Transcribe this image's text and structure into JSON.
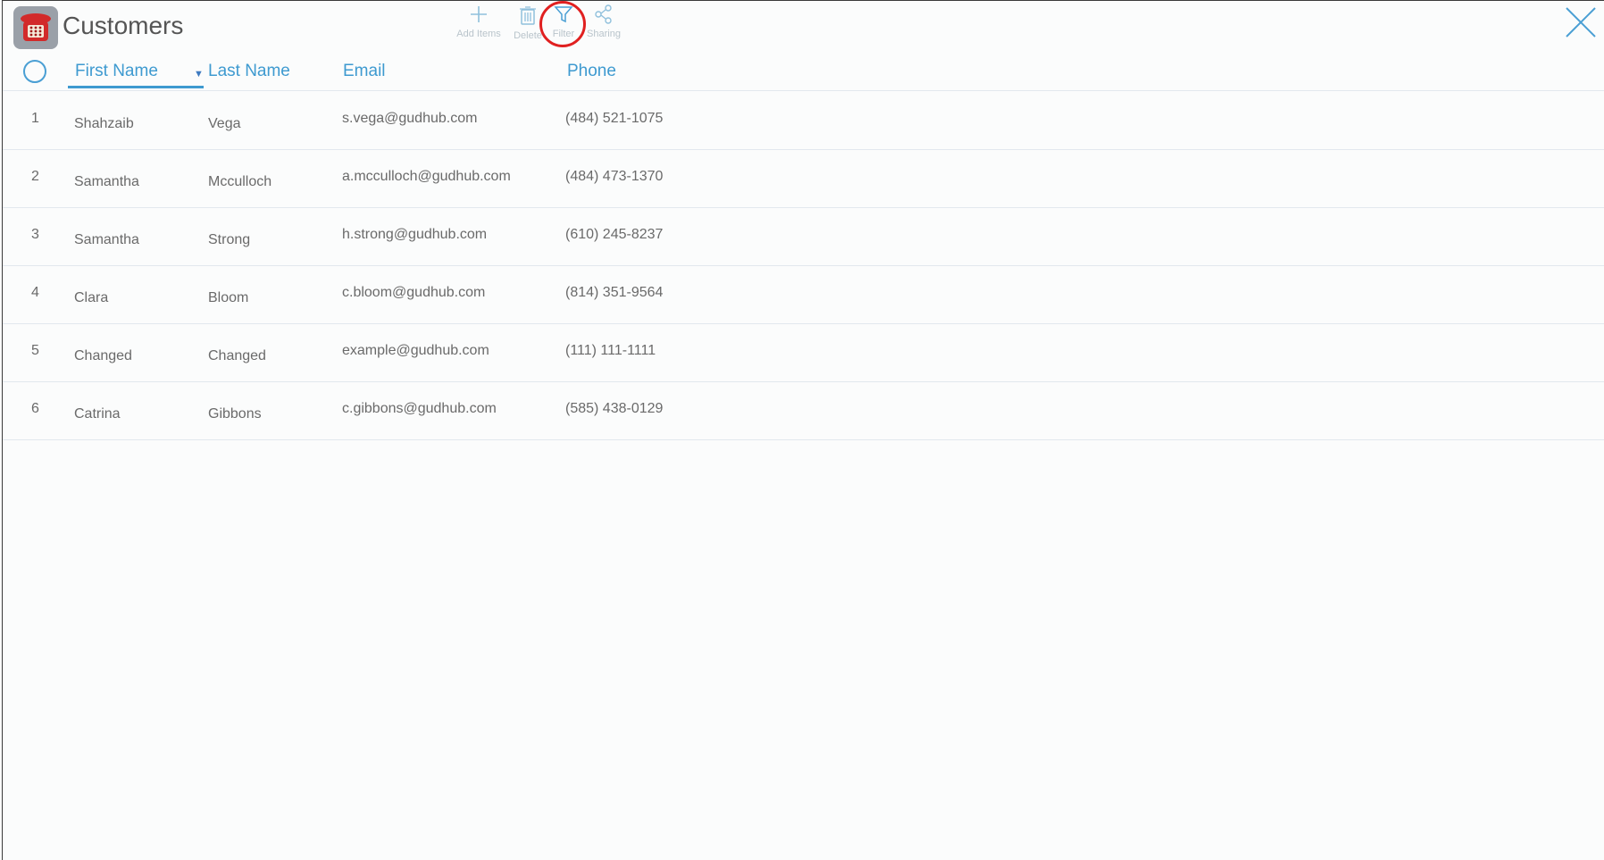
{
  "header": {
    "title": "Customers",
    "toolbar": {
      "add_label": "Add Items",
      "delete_label": "Delete",
      "filter_label": "Filter",
      "sharing_label": "Sharing"
    }
  },
  "table": {
    "columns": [
      "First Name",
      "Last Name",
      "Email",
      "Phone"
    ],
    "rows": [
      {
        "num": "1",
        "first": "Shahzaib",
        "last": "Vega",
        "email": "s.vega@gudhub.com",
        "phone": "(484) 521-1075"
      },
      {
        "num": "2",
        "first": "Samantha",
        "last": "Mcculloch",
        "email": "a.mcculloch@gudhub.com",
        "phone": "(484) 473-1370"
      },
      {
        "num": "3",
        "first": "Samantha",
        "last": "Strong",
        "email": "h.strong@gudhub.com",
        "phone": "(610) 245-8237"
      },
      {
        "num": "4",
        "first": "Clara",
        "last": "Bloom",
        "email": "c.bloom@gudhub.com",
        "phone": "(814) 351-9564"
      },
      {
        "num": "5",
        "first": "Changed",
        "last": "Changed",
        "email": "example@gudhub.com",
        "phone": "(111) 111-1111"
      },
      {
        "num": "6",
        "first": "Catrina",
        "last": "Gibbons",
        "email": "c.gibbons@gudhub.com",
        "phone": "(585) 438-0129"
      }
    ]
  },
  "colors": {
    "accent": "#3e9ad0",
    "highlight": "#e02020"
  }
}
